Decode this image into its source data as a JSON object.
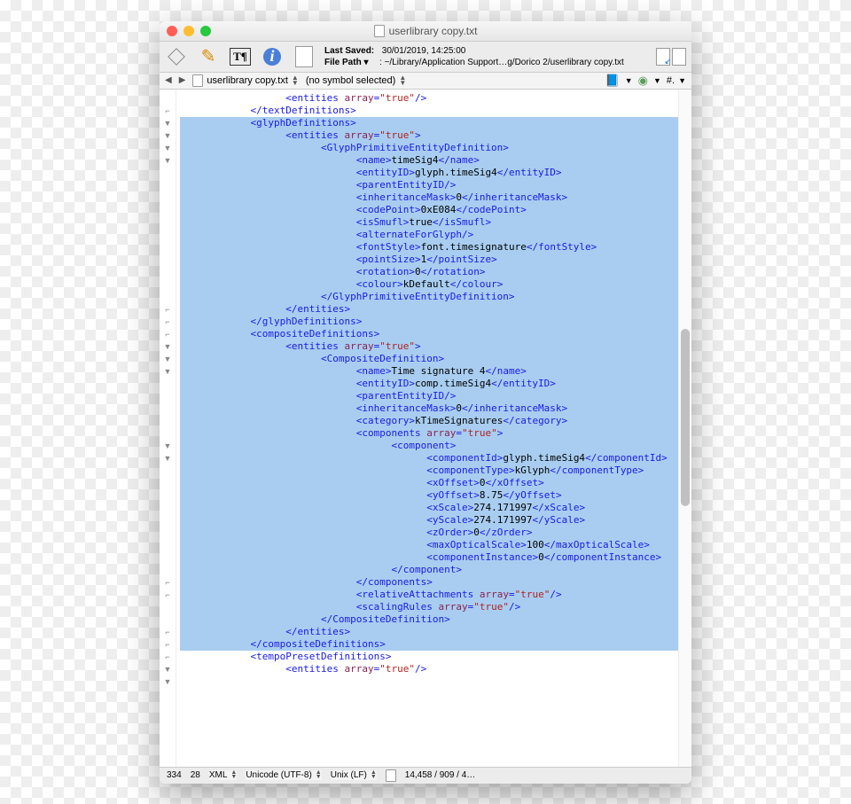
{
  "title": "userlibrary copy.txt",
  "meta": {
    "lastSavedLabel": "Last Saved:",
    "lastSaved": "30/01/2019, 14:25:00",
    "filePathLabel": "File Path",
    "filePath": "~/Library/Application Support…g/Dorico 2/userlibrary copy.txt"
  },
  "nav": {
    "file": "userlibrary copy.txt",
    "symbol": "(no symbol selected)",
    "hash": "#."
  },
  "status": {
    "line": "334",
    "col": "28",
    "lang": "XML",
    "enc": "Unicode (UTF-8)",
    "eol": "Unix (LF)",
    "counts": "14,458 / 909 / 4…"
  },
  "gutter": [
    "",
    "⌐",
    "▼",
    "▼",
    "▼",
    "▼",
    "",
    "",
    "",
    "",
    "",
    "",
    "",
    "",
    "",
    "",
    "",
    "⌐",
    "⌐",
    "⌐",
    "▼",
    "▼",
    "▼",
    "",
    "",
    "",
    "",
    "",
    "▼",
    "▼",
    "",
    "",
    "",
    "",
    "",
    "",
    "",
    "",
    "",
    "⌐",
    "⌐",
    "",
    "",
    "⌐",
    "⌐",
    "⌐",
    "▼",
    "▼",
    ""
  ],
  "code": [
    {
      "i": 6,
      "p": [
        [
          "t",
          "<entities "
        ],
        [
          "a",
          "array"
        ],
        [
          "t",
          "="
        ],
        [
          "s",
          "\"true\""
        ],
        [
          "t",
          "/>"
        ]
      ]
    },
    {
      "i": 4,
      "p": [
        [
          "t",
          "</textDefinitions>"
        ]
      ]
    },
    {
      "i": 4,
      "h": 1,
      "p": [
        [
          "t",
          "<glyphDefinitions>"
        ]
      ]
    },
    {
      "i": 6,
      "h": 1,
      "p": [
        [
          "t",
          "<entities "
        ],
        [
          "a",
          "array"
        ],
        [
          "t",
          "="
        ],
        [
          "s",
          "\"true\""
        ],
        [
          "t",
          ">"
        ]
      ]
    },
    {
      "i": 8,
      "h": 1,
      "p": [
        [
          "t",
          "<GlyphPrimitiveEntityDefinition>"
        ]
      ]
    },
    {
      "i": 10,
      "h": 1,
      "p": [
        [
          "t",
          "<name>"
        ],
        [
          "x",
          "timeSig4"
        ],
        [
          "t",
          "</name>"
        ]
      ]
    },
    {
      "i": 10,
      "h": 1,
      "p": [
        [
          "t",
          "<entityID>"
        ],
        [
          "x",
          "glyph.timeSig4"
        ],
        [
          "t",
          "</entityID>"
        ]
      ]
    },
    {
      "i": 10,
      "h": 1,
      "p": [
        [
          "t",
          "<parentEntityID/>"
        ]
      ]
    },
    {
      "i": 10,
      "h": 1,
      "p": [
        [
          "t",
          "<inheritanceMask>"
        ],
        [
          "x",
          "0"
        ],
        [
          "t",
          "</inheritanceMask>"
        ]
      ]
    },
    {
      "i": 10,
      "h": 1,
      "p": [
        [
          "t",
          "<codePoint>"
        ],
        [
          "x",
          "0xE084"
        ],
        [
          "t",
          "</codePoint>"
        ]
      ]
    },
    {
      "i": 10,
      "h": 1,
      "p": [
        [
          "t",
          "<isSmufl>"
        ],
        [
          "x",
          "true"
        ],
        [
          "t",
          "</isSmufl>"
        ]
      ]
    },
    {
      "i": 10,
      "h": 1,
      "p": [
        [
          "t",
          "<alternateForGlyph/>"
        ]
      ]
    },
    {
      "i": 10,
      "h": 1,
      "p": [
        [
          "t",
          "<fontStyle>"
        ],
        [
          "x",
          "font.timesignature"
        ],
        [
          "t",
          "</fontStyle>"
        ]
      ]
    },
    {
      "i": 10,
      "h": 1,
      "p": [
        [
          "t",
          "<pointSize>"
        ],
        [
          "x",
          "1"
        ],
        [
          "t",
          "</pointSize>"
        ]
      ]
    },
    {
      "i": 10,
      "h": 1,
      "p": [
        [
          "t",
          "<rotation>"
        ],
        [
          "x",
          "0"
        ],
        [
          "t",
          "</rotation>"
        ]
      ]
    },
    {
      "i": 10,
      "h": 1,
      "p": [
        [
          "t",
          "<colour>"
        ],
        [
          "x",
          "kDefault"
        ],
        [
          "t",
          "</colour>"
        ]
      ]
    },
    {
      "i": 8,
      "h": 1,
      "p": [
        [
          "t",
          "</GlyphPrimitiveEntityDefinition>"
        ]
      ]
    },
    {
      "i": 6,
      "h": 1,
      "p": [
        [
          "t",
          "</entities>"
        ]
      ]
    },
    {
      "i": 4,
      "h": 1,
      "p": [
        [
          "t",
          "</glyphDefinitions>"
        ]
      ]
    },
    {
      "i": 4,
      "h": 1,
      "p": [
        [
          "t",
          "<compositeDefinitions>"
        ]
      ]
    },
    {
      "i": 6,
      "h": 1,
      "p": [
        [
          "t",
          "<entities "
        ],
        [
          "a",
          "array"
        ],
        [
          "t",
          "="
        ],
        [
          "s",
          "\"true\""
        ],
        [
          "t",
          ">"
        ]
      ]
    },
    {
      "i": 8,
      "h": 1,
      "p": [
        [
          "t",
          "<CompositeDefinition>"
        ]
      ]
    },
    {
      "i": 10,
      "h": 1,
      "p": [
        [
          "t",
          "<name>"
        ],
        [
          "x",
          "Time signature 4"
        ],
        [
          "t",
          "</name>"
        ]
      ]
    },
    {
      "i": 10,
      "h": 1,
      "p": [
        [
          "t",
          "<entityID>"
        ],
        [
          "x",
          "comp.timeSig4"
        ],
        [
          "t",
          "</entityID>"
        ]
      ]
    },
    {
      "i": 10,
      "h": 1,
      "p": [
        [
          "t",
          "<parentEntityID/>"
        ]
      ]
    },
    {
      "i": 10,
      "h": 1,
      "p": [
        [
          "t",
          "<inheritanceMask>"
        ],
        [
          "x",
          "0"
        ],
        [
          "t",
          "</inheritanceMask>"
        ]
      ]
    },
    {
      "i": 10,
      "h": 1,
      "p": [
        [
          "t",
          "<category>"
        ],
        [
          "x",
          "kTimeSignatures"
        ],
        [
          "t",
          "</category>"
        ]
      ]
    },
    {
      "i": 10,
      "h": 1,
      "p": [
        [
          "t",
          "<components "
        ],
        [
          "a",
          "array"
        ],
        [
          "t",
          "="
        ],
        [
          "s",
          "\"true\""
        ],
        [
          "t",
          ">"
        ]
      ]
    },
    {
      "i": 12,
      "h": 1,
      "p": [
        [
          "t",
          "<component>"
        ]
      ]
    },
    {
      "i": 14,
      "h": 1,
      "p": [
        [
          "t",
          "<componentId>"
        ],
        [
          "x",
          "glyph.timeSig4"
        ],
        [
          "t",
          "</componentId>"
        ]
      ]
    },
    {
      "i": 14,
      "h": 1,
      "p": [
        [
          "t",
          "<componentType>"
        ],
        [
          "x",
          "kGlyph"
        ],
        [
          "t",
          "</componentType>"
        ]
      ]
    },
    {
      "i": 14,
      "h": 1,
      "p": [
        [
          "t",
          "<xOffset>"
        ],
        [
          "x",
          "0"
        ],
        [
          "t",
          "</xOffset>"
        ]
      ]
    },
    {
      "i": 14,
      "h": 1,
      "p": [
        [
          "t",
          "<yOffset>"
        ],
        [
          "x",
          "8.75"
        ],
        [
          "t",
          "</yOffset>"
        ]
      ]
    },
    {
      "i": 14,
      "h": 1,
      "p": [
        [
          "t",
          "<xScale>"
        ],
        [
          "x",
          "274.171997"
        ],
        [
          "t",
          "</xScale>"
        ]
      ]
    },
    {
      "i": 14,
      "h": 1,
      "p": [
        [
          "t",
          "<yScale>"
        ],
        [
          "x",
          "274.171997"
        ],
        [
          "t",
          "</yScale>"
        ]
      ]
    },
    {
      "i": 14,
      "h": 1,
      "p": [
        [
          "t",
          "<zOrder>"
        ],
        [
          "x",
          "0"
        ],
        [
          "t",
          "</zOrder>"
        ]
      ]
    },
    {
      "i": 14,
      "h": 1,
      "p": [
        [
          "t",
          "<maxOpticalScale>"
        ],
        [
          "x",
          "100"
        ],
        [
          "t",
          "</maxOpticalScale>"
        ]
      ]
    },
    {
      "i": 14,
      "h": 1,
      "p": [
        [
          "t",
          "<componentInstance>"
        ],
        [
          "x",
          "0"
        ],
        [
          "t",
          "</componentInstance>"
        ]
      ]
    },
    {
      "i": 12,
      "h": 1,
      "p": [
        [
          "t",
          "</component>"
        ]
      ]
    },
    {
      "i": 10,
      "h": 1,
      "p": [
        [
          "t",
          "</components>"
        ]
      ]
    },
    {
      "i": 10,
      "h": 1,
      "p": [
        [
          "t",
          "<relativeAttachments "
        ],
        [
          "a",
          "array"
        ],
        [
          "t",
          "="
        ],
        [
          "s",
          "\"true\""
        ],
        [
          "t",
          "/>"
        ]
      ]
    },
    {
      "i": 10,
      "h": 1,
      "p": [
        [
          "t",
          "<scalingRules "
        ],
        [
          "a",
          "array"
        ],
        [
          "t",
          "="
        ],
        [
          "s",
          "\"true\""
        ],
        [
          "t",
          "/>"
        ]
      ]
    },
    {
      "i": 8,
      "h": 1,
      "p": [
        [
          "t",
          "</CompositeDefinition>"
        ]
      ]
    },
    {
      "i": 6,
      "h": 1,
      "p": [
        [
          "t",
          "</entities>"
        ]
      ]
    },
    {
      "i": 4,
      "h": 1,
      "p": [
        [
          "t",
          "</compositeDefinitions>"
        ]
      ]
    },
    {
      "i": 4,
      "p": [
        [
          "t",
          "<tempoPresetDefinitions>"
        ]
      ]
    },
    {
      "i": 6,
      "p": [
        [
          "t",
          "<entities "
        ],
        [
          "a",
          "array"
        ],
        [
          "t",
          "="
        ],
        [
          "s",
          "\"true\""
        ],
        [
          "t",
          "/>"
        ]
      ]
    }
  ]
}
